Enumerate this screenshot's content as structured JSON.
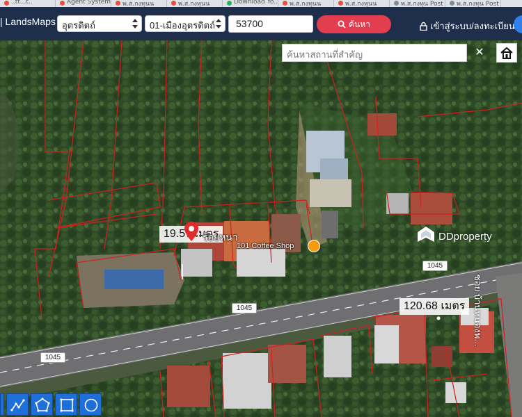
{
  "browser_tabs": [
    {
      "label": "..tt...t..",
      "icon": "red-dot-icon"
    },
    {
      "label": "Agent System",
      "icon": "red-dot-icon"
    },
    {
      "label": "พ.ส.กงทุนน",
      "icon": "red-dot-icon"
    },
    {
      "label": "พ.ส.กงทุนน",
      "icon": "red-dot-icon"
    },
    {
      "label": "Download Yo..",
      "icon": "green-dot-icon"
    },
    {
      "label": "พ.ส.กงทุนน",
      "icon": "red-dot-icon"
    },
    {
      "label": "พ.ส.กงทุนน",
      "icon": "red-dot-icon"
    },
    {
      "label": "พ.ส.กงทุน Post",
      "icon": "gray-dot-icon"
    },
    {
      "label": "พ.ส.กงทุน Post",
      "icon": "gray-dot-icon"
    }
  ],
  "header": {
    "brand": "| LandsMaps",
    "province": "อุตรดิตถ์",
    "district": "01-เมืองอุตรดิตถ์",
    "postal_code": "53700",
    "search_label": "ค้นหา",
    "login_label": "เข้าสู่ระบบ/ลงทะเบียน"
  },
  "map": {
    "place_search_placeholder": "ค้นหาสถานที่สำคัญ",
    "close_symbol": "✕",
    "measure_1": "19.57 เมตร",
    "measure_2": "120.68 เมตร",
    "shop_label": "ร้อยหนา",
    "coffee_label": "101 Coffee Shop",
    "road_labels": [
      "1045",
      "1045",
      "1045"
    ],
    "side_road_label": "ซอย บ้านหนองพ...",
    "watermark": "DDproperty"
  },
  "colors": {
    "header_bg": "#1f2f4b",
    "search_button": "#e23e4f",
    "tool_button": "#1e6fd9",
    "parcel_line": "#d02020"
  }
}
